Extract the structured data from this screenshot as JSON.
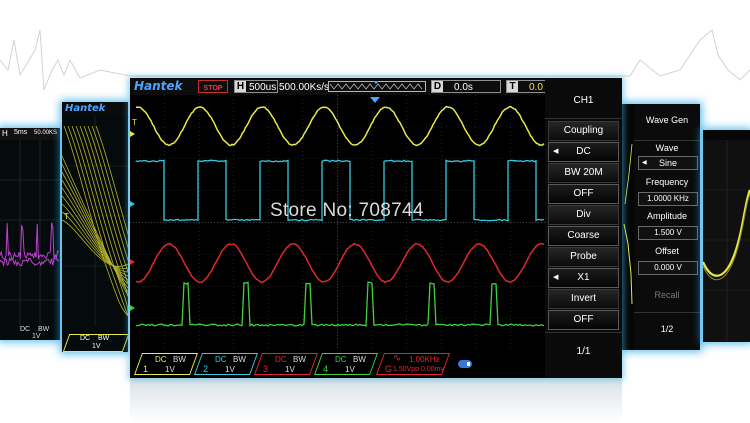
{
  "watermark": "Store No: 708744",
  "left_panel": {
    "timebase_label": "H",
    "timebase_value": "5ms",
    "rate": "50.00KS",
    "ch_coupling": "DC",
    "ch_bw": "BW",
    "ch_scale": "1V"
  },
  "second_panel": {
    "brand": "Hantek",
    "marker": "T",
    "ch_coupling": "DC",
    "ch_bw": "BW",
    "ch_scale": "1V"
  },
  "scope": {
    "brand": "Hantek",
    "run_state": "STOP",
    "timebase_label": "H",
    "timebase_value": "500us",
    "sample_rate": "500.00Ks/s",
    "delay_label": "D",
    "delay_value": "0.0s",
    "trigger_label": "T",
    "trigger_value": "0.0",
    "trigger_marker": "T",
    "menu": {
      "title": "CH1",
      "items": [
        {
          "label": "Coupling",
          "type": "header"
        },
        {
          "label": "DC",
          "type": "select"
        },
        {
          "label": "BW 20M",
          "type": "header"
        },
        {
          "label": "OFF",
          "type": "value"
        },
        {
          "label": "Div",
          "type": "header"
        },
        {
          "label": "Coarse",
          "type": "value"
        },
        {
          "label": "Probe",
          "type": "header"
        },
        {
          "label": "X1",
          "type": "select"
        },
        {
          "label": "Invert",
          "type": "header"
        },
        {
          "label": "OFF",
          "type": "value"
        }
      ],
      "page": "1/1"
    },
    "channels": [
      {
        "num": "1",
        "coupling": "DC",
        "bw": "BW",
        "scale": "1V",
        "color": "#e8e84a"
      },
      {
        "num": "2",
        "coupling": "DC",
        "bw": "BW",
        "scale": "1V",
        "color": "#37c8e0"
      },
      {
        "num": "3",
        "coupling": "DC",
        "bw": "BW",
        "scale": "1V",
        "color": "#e0282c"
      },
      {
        "num": "4",
        "coupling": "DC",
        "bw": "BW",
        "scale": "1V",
        "color": "#3ed03e"
      }
    ],
    "generator": {
      "num": "G",
      "freq": "1.00KHz",
      "amp": "1.50Vpp 0.00mv",
      "color": "#e0282c"
    }
  },
  "wave_gen": {
    "title": "Wave Gen",
    "wave_label": "Wave",
    "wave_value": "Sine",
    "frequency_label": "Frequency",
    "frequency_value": "1.0000 KHz",
    "amplitude_label": "Amplitude",
    "amplitude_value": "1.500 V",
    "offset_label": "Offset",
    "offset_value": "0.000 V",
    "recall_label": "Recall",
    "page": "1/2"
  },
  "colors": {
    "ch1": "#e8e84a",
    "ch2": "#37c8e0",
    "ch3": "#e0282c",
    "ch4": "#3ed03e",
    "brand": "#4da3ff",
    "glow": "#28aae6"
  }
}
